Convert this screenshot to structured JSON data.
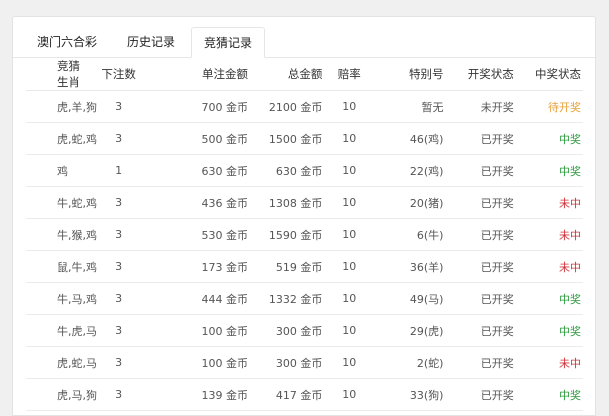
{
  "tabs": [
    {
      "label": "澳门六合彩"
    },
    {
      "label": "历史记录"
    },
    {
      "label": "竞猜记录"
    }
  ],
  "table": {
    "headers": [
      "竞猜生肖",
      "下注数",
      "单注金额",
      "总金额",
      "赔率",
      "特别号",
      "开奖状态",
      "中奖状态"
    ],
    "rows": [
      {
        "zodiac": "虎,羊,狗",
        "count": "3",
        "unit": "700 金币",
        "total": "2100 金币",
        "odds": "10",
        "special": "暂无",
        "draw": "未开奖",
        "win": "待开奖"
      },
      {
        "zodiac": "虎,蛇,鸡",
        "count": "3",
        "unit": "500 金币",
        "total": "1500 金币",
        "odds": "10",
        "special": "46(鸡)",
        "draw": "已开奖",
        "win": "中奖"
      },
      {
        "zodiac": "鸡",
        "count": "1",
        "unit": "630 金币",
        "total": "630 金币",
        "odds": "10",
        "special": "22(鸡)",
        "draw": "已开奖",
        "win": "中奖"
      },
      {
        "zodiac": "牛,蛇,鸡",
        "count": "3",
        "unit": "436 金币",
        "total": "1308 金币",
        "odds": "10",
        "special": "20(猪)",
        "draw": "已开奖",
        "win": "未中"
      },
      {
        "zodiac": "牛,猴,鸡",
        "count": "3",
        "unit": "530 金币",
        "total": "1590 金币",
        "odds": "10",
        "special": "6(牛)",
        "draw": "已开奖",
        "win": "未中"
      },
      {
        "zodiac": "鼠,牛,鸡",
        "count": "3",
        "unit": "173 金币",
        "total": "519 金币",
        "odds": "10",
        "special": "36(羊)",
        "draw": "已开奖",
        "win": "未中"
      },
      {
        "zodiac": "牛,马,鸡",
        "count": "3",
        "unit": "444 金币",
        "total": "1332 金币",
        "odds": "10",
        "special": "49(马)",
        "draw": "已开奖",
        "win": "中奖"
      },
      {
        "zodiac": "牛,虎,马",
        "count": "3",
        "unit": "100 金币",
        "total": "300 金币",
        "odds": "10",
        "special": "29(虎)",
        "draw": "已开奖",
        "win": "中奖"
      },
      {
        "zodiac": "虎,蛇,马",
        "count": "3",
        "unit": "100 金币",
        "total": "300 金币",
        "odds": "10",
        "special": "2(蛇)",
        "draw": "已开奖",
        "win": "未中"
      },
      {
        "zodiac": "虎,马,狗",
        "count": "3",
        "unit": "139 金币",
        "total": "417 金币",
        "odds": "10",
        "special": "33(狗)",
        "draw": "已开奖",
        "win": "中奖"
      }
    ]
  },
  "status_colors": {
    "待开奖": "#e6a23c",
    "中奖": "#2e9a3e",
    "未中": "#d0343a"
  }
}
